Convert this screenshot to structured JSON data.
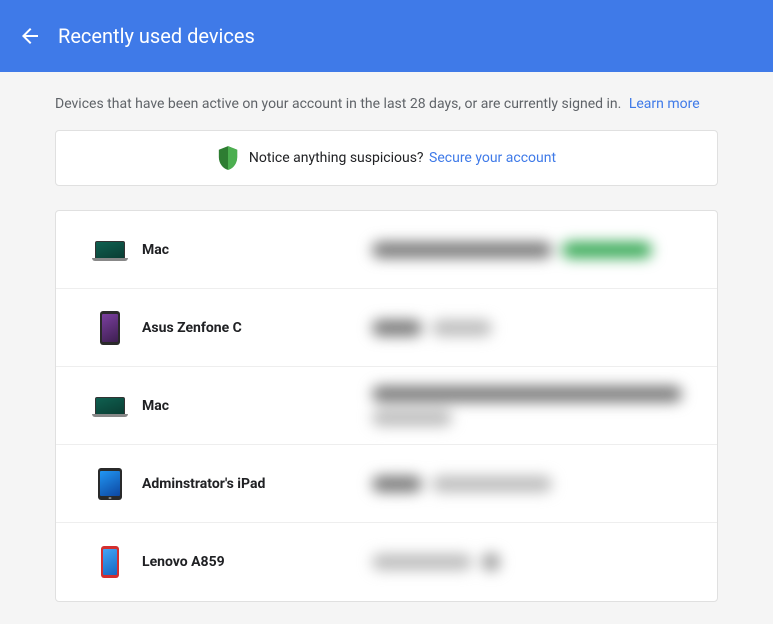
{
  "header": {
    "title": "Recently used devices"
  },
  "subtitle": {
    "text": "Devices that have been active on your account in the last 28 days, or are currently signed in.",
    "learn_more": "Learn more"
  },
  "notice": {
    "text": "Notice anything suspicious?",
    "secure_link": "Secure your account"
  },
  "devices": [
    {
      "name": "Mac",
      "icon": "mac"
    },
    {
      "name": "Asus Zenfone C",
      "icon": "phone-purple"
    },
    {
      "name": "Mac",
      "icon": "mac"
    },
    {
      "name": "Adminstrator's iPad",
      "icon": "ipad"
    },
    {
      "name": "Lenovo A859",
      "icon": "phone-red"
    }
  ]
}
